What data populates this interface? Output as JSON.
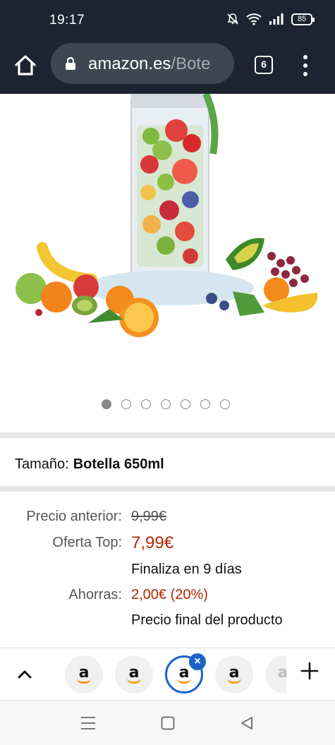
{
  "status_bar": {
    "time": "19:17",
    "battery": "85"
  },
  "browser": {
    "url_domain": "amazon.es",
    "url_path": "/Bote",
    "tab_count": "6"
  },
  "product": {
    "carousel": {
      "total": 7,
      "active_index": 0
    },
    "size_label": "Tamaño:",
    "size_value": "Botella 650ml"
  },
  "pricing": {
    "previous_label": "Precio anterior:",
    "previous_value": "9,99€",
    "offer_label": "Oferta Top:",
    "offer_value": "7,99€",
    "offer_note": "Finaliza en 9 días",
    "savings_label": "Ahorras:",
    "savings_value": "2,00€ (20%)",
    "final_note": "Precio final del producto"
  },
  "tab_strip": {
    "tabs": [
      {
        "letter": "a",
        "selected": false
      },
      {
        "letter": "a",
        "selected": false
      },
      {
        "letter": "a",
        "selected": true
      },
      {
        "letter": "a",
        "selected": false
      },
      {
        "letter": "a",
        "selected": false
      }
    ],
    "close_glyph": "×"
  },
  "colors": {
    "accent_blue": "#1a62c9",
    "price_red": "#b12704",
    "amazon_orange": "#f29a1a",
    "top_bar": "#1b2430"
  }
}
